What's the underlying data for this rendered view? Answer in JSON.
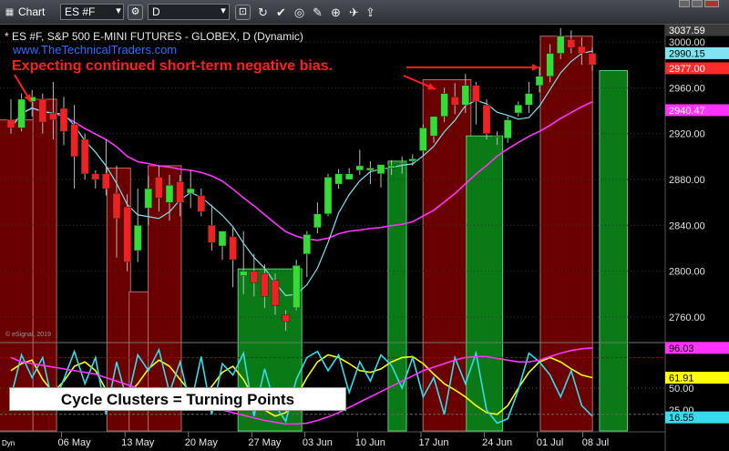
{
  "toolbar": {
    "title": "Chart",
    "symbol": "ES #F",
    "interval": "D"
  },
  "header": {
    "instrument": "* ES #F, S&P 500 E-MINI FUTURES - GLOBEX, D (Dynamic)",
    "website": "www.TheTechnicalTraders.com",
    "note": "Expecting continued short-term negative bias.",
    "watermark": "© eSignal, 2019",
    "footer_tag": "Dyn",
    "caption": "Cycle Clusters = Turning Points"
  },
  "chart_data": [
    {
      "type": "candlestick",
      "title": "* ES #F, S&P 500 E-MINI FUTURES - GLOBEX, D (Dynamic)",
      "ylim": [
        2728,
        3040
      ],
      "y_ticks": [
        "2760.00",
        "2800.00",
        "2840.00",
        "2880.00",
        "2920.00",
        "2960.00",
        "3000.00"
      ],
      "x_ticks": [
        "06 May",
        "13 May",
        "20 May",
        "27 May",
        "03 Jun",
        "10 Jun",
        "17 Jun",
        "24 Jun",
        "01 Jul",
        "08 Jul"
      ],
      "price_labels": [
        {
          "value": 3037.59,
          "text": "3037.59",
          "color": "#3a3a3a"
        },
        {
          "value": 2990.15,
          "text": "2990.15",
          "color": "#7fe3f0"
        },
        {
          "value": 2977.0,
          "text": "2977.00",
          "color": "#ff2a2a"
        },
        {
          "value": 2940.47,
          "text": "2940.47",
          "color": "#ff33ff"
        }
      ],
      "candles": [
        {
          "o": 2932,
          "h": 2950,
          "l": 2920,
          "c": 2925
        },
        {
          "o": 2925,
          "h": 2955,
          "l": 2922,
          "c": 2950
        },
        {
          "o": 2948,
          "h": 2958,
          "l": 2935,
          "c": 2952
        },
        {
          "o": 2950,
          "h": 2955,
          "l": 2920,
          "c": 2930
        },
        {
          "o": 2938,
          "h": 2965,
          "l": 2915,
          "c": 2932
        },
        {
          "o": 2942,
          "h": 2952,
          "l": 2910,
          "c": 2922
        },
        {
          "o": 2928,
          "h": 2945,
          "l": 2872,
          "c": 2900
        },
        {
          "o": 2915,
          "h": 2920,
          "l": 2880,
          "c": 2885
        },
        {
          "o": 2885,
          "h": 2888,
          "l": 2872,
          "c": 2880
        },
        {
          "o": 2885,
          "h": 2915,
          "l": 2866,
          "c": 2872
        },
        {
          "o": 2868,
          "h": 2892,
          "l": 2812,
          "c": 2846
        },
        {
          "o": 2856,
          "h": 2867,
          "l": 2800,
          "c": 2808
        },
        {
          "o": 2818,
          "h": 2872,
          "l": 2808,
          "c": 2840
        },
        {
          "o": 2855,
          "h": 2883,
          "l": 2840,
          "c": 2872
        },
        {
          "o": 2882,
          "h": 2892,
          "l": 2852,
          "c": 2864
        },
        {
          "o": 2860,
          "h": 2884,
          "l": 2844,
          "c": 2875
        },
        {
          "o": 2878,
          "h": 2884,
          "l": 2848,
          "c": 2860
        },
        {
          "o": 2868,
          "h": 2888,
          "l": 2855,
          "c": 2872
        },
        {
          "o": 2866,
          "h": 2872,
          "l": 2848,
          "c": 2852
        },
        {
          "o": 2840,
          "h": 2858,
          "l": 2818,
          "c": 2825
        },
        {
          "o": 2822,
          "h": 2828,
          "l": 2810,
          "c": 2835
        },
        {
          "o": 2830,
          "h": 2838,
          "l": 2786,
          "c": 2810
        },
        {
          "o": 2796,
          "h": 2835,
          "l": 2780,
          "c": 2800
        },
        {
          "o": 2800,
          "h": 2815,
          "l": 2778,
          "c": 2790
        },
        {
          "o": 2798,
          "h": 2806,
          "l": 2768,
          "c": 2778
        },
        {
          "o": 2792,
          "h": 2798,
          "l": 2762,
          "c": 2770
        },
        {
          "o": 2762,
          "h": 2766,
          "l": 2748,
          "c": 2756
        },
        {
          "o": 2768,
          "h": 2810,
          "l": 2766,
          "c": 2805
        },
        {
          "o": 2815,
          "h": 2835,
          "l": 2795,
          "c": 2832
        },
        {
          "o": 2838,
          "h": 2860,
          "l": 2833,
          "c": 2850
        },
        {
          "o": 2850,
          "h": 2885,
          "l": 2848,
          "c": 2882
        },
        {
          "o": 2876,
          "h": 2889,
          "l": 2872,
          "c": 2885
        },
        {
          "o": 2880,
          "h": 2890,
          "l": 2880,
          "c": 2885
        },
        {
          "o": 2888,
          "h": 2906,
          "l": 2884,
          "c": 2892
        },
        {
          "o": 2888,
          "h": 2896,
          "l": 2876,
          "c": 2890
        },
        {
          "o": 2885,
          "h": 2892,
          "l": 2873,
          "c": 2893
        },
        {
          "o": 2890,
          "h": 2897,
          "l": 2884,
          "c": 2892
        },
        {
          "o": 2894,
          "h": 2900,
          "l": 2885,
          "c": 2895
        },
        {
          "o": 2896,
          "h": 2902,
          "l": 2892,
          "c": 2898
        },
        {
          "o": 2905,
          "h": 2928,
          "l": 2900,
          "c": 2925
        },
        {
          "o": 2918,
          "h": 2935,
          "l": 2912,
          "c": 2935
        },
        {
          "o": 2935,
          "h": 2960,
          "l": 2930,
          "c": 2955
        },
        {
          "o": 2952,
          "h": 2964,
          "l": 2937,
          "c": 2945
        },
        {
          "o": 2945,
          "h": 2972,
          "l": 2938,
          "c": 2962
        },
        {
          "o": 2962,
          "h": 2965,
          "l": 2928,
          "c": 2948
        },
        {
          "o": 2945,
          "h": 2950,
          "l": 2915,
          "c": 2920
        },
        {
          "o": 2918,
          "h": 2922,
          "l": 2910,
          "c": 2918
        },
        {
          "o": 2916,
          "h": 2935,
          "l": 2912,
          "c": 2932
        },
        {
          "o": 2938,
          "h": 2948,
          "l": 2935,
          "c": 2945
        },
        {
          "o": 2945,
          "h": 2965,
          "l": 2938,
          "c": 2955
        },
        {
          "o": 2962,
          "h": 2978,
          "l": 2956,
          "c": 2970
        },
        {
          "o": 2970,
          "h": 2998,
          "l": 2965,
          "c": 2990
        },
        {
          "o": 2990,
          "h": 3012,
          "l": 2985,
          "c": 3005
        },
        {
          "o": 3002,
          "h": 3010,
          "l": 2990,
          "c": 2995
        },
        {
          "o": 2996,
          "h": 3004,
          "l": 2980,
          "c": 2990
        },
        {
          "o": 2990,
          "h": 2995,
          "l": 2975,
          "c": 2980
        }
      ],
      "projected_bar": {
        "from": 2975,
        "to": 2728
      }
    },
    {
      "type": "line",
      "ylim": [
        0,
        100
      ],
      "y_ticks": [
        "50.00",
        "25.00"
      ],
      "price_labels": [
        {
          "value": 96.03,
          "text": "96.03",
          "color": "#ff33ff"
        },
        {
          "value": 61.91,
          "text": "61.91",
          "color": "#ffff00"
        },
        {
          "value": 16.55,
          "text": "16.55",
          "color": "#33ddee"
        }
      ],
      "series": [
        {
          "color": "#ffff00",
          "values": [
            70,
            78,
            82,
            60,
            45,
            58,
            75,
            80,
            70,
            48,
            35,
            42,
            55,
            72,
            82,
            75,
            60,
            45,
            40,
            52,
            68,
            75,
            60,
            38,
            25,
            18,
            22,
            40,
            62,
            80,
            88,
            85,
            78,
            70,
            68,
            72,
            80,
            85,
            86,
            78,
            66,
            55,
            48,
            40,
            30,
            22,
            20,
            30,
            50,
            68,
            80,
            85,
            80,
            72,
            65,
            62
          ]
        },
        {
          "color": "#33ddee",
          "values": [
            40,
            88,
            62,
            85,
            30,
            60,
            92,
            55,
            85,
            20,
            80,
            35,
            88,
            70,
            94,
            45,
            80,
            30,
            86,
            20,
            78,
            65,
            90,
            18,
            72,
            30,
            12,
            60,
            85,
            92,
            70,
            88,
            45,
            80,
            58,
            88,
            76,
            50,
            85,
            40,
            62,
            20,
            85,
            55,
            90,
            25,
            10,
            15,
            48,
            90,
            80,
            65,
            40,
            70,
            30,
            18
          ]
        },
        {
          "color": "#ff33ff",
          "values": [
            85,
            80,
            78,
            76,
            74,
            72,
            70,
            68,
            66,
            62,
            58,
            54,
            50,
            47,
            44,
            41,
            38,
            35,
            32,
            28,
            25,
            22,
            19,
            16,
            13,
            11,
            9,
            9,
            10,
            13,
            17,
            22,
            28,
            34,
            40,
            46,
            52,
            58,
            64,
            70,
            74,
            78,
            82,
            85,
            86,
            86,
            84,
            82,
            80,
            80,
            82,
            86,
            90,
            93,
            95,
            96
          ]
        }
      ]
    }
  ]
}
